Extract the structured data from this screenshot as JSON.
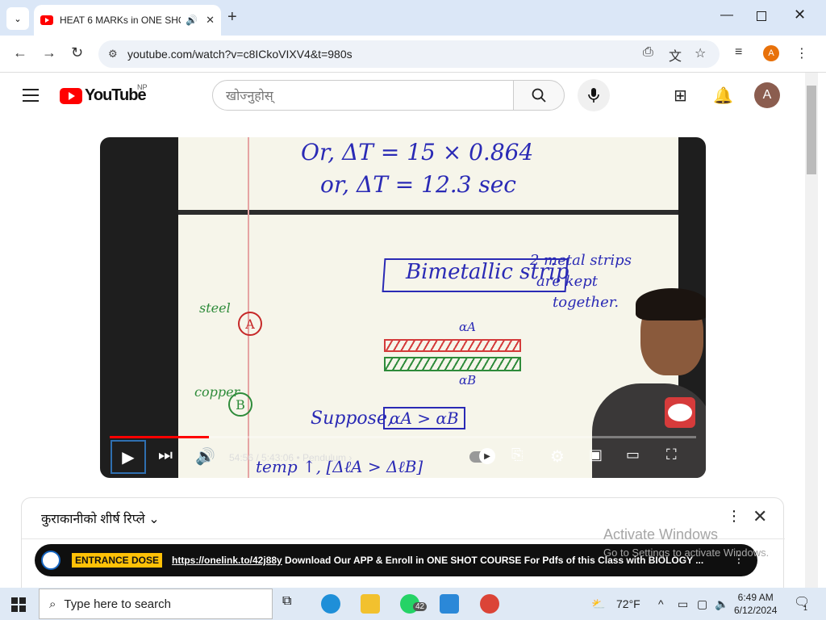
{
  "browser": {
    "tab_title": "HEAT 6 MARKs in ONE SHO",
    "tab_audio_icon": "speaker-icon",
    "url": "youtube.com/watch?v=c8ICkoVIXV4&t=980s",
    "profile_initial": "A"
  },
  "youtube": {
    "logo_text": "YouTube",
    "country_code": "NP",
    "search_placeholder": "खोज्नुहोस्",
    "user_initial": "A"
  },
  "video": {
    "board_lines": {
      "line1": "Or, ΔT = 15 × 0.864",
      "line2": "or, ΔT = 12.3 sec",
      "bimetallic": "Bimetallic strip",
      "note1": "2 metal strips",
      "note2": "are kept",
      "note3": "together.",
      "steel": "steel",
      "copper": "copper",
      "circle_a": "A",
      "circle_b": "B",
      "alpha_a": "αA",
      "alpha_b": "αB",
      "suppose": "Suppose,",
      "suppose_box": "αA > αB",
      "bottom": "temp ↑, [ΔℓA > ΔℓB]"
    },
    "progress_fraction": 0.169,
    "time_current": "54:56",
    "time_total": "5:43:06",
    "chapter": "Pendulum"
  },
  "chat": {
    "title": "कुराकानीको शीर्ष रिप्ले",
    "pinned_badge": "ENTRANCE DOSE",
    "pinned_link": "https://onelink.to/42j88y",
    "pinned_text": " Download Our APP & Enroll in ONE SHOT COURSE For Pdfs of this Class with BIOLOGY ..."
  },
  "windows_watermark": {
    "line1": "Activate Windows",
    "line2": "Go to Settings to activate Windows."
  },
  "taskbar": {
    "search_placeholder": "Type here to search",
    "whatsapp_badge": "42",
    "weather": "72°F",
    "time": "6:49 AM",
    "date": "6/12/2024",
    "notifications": "1"
  }
}
